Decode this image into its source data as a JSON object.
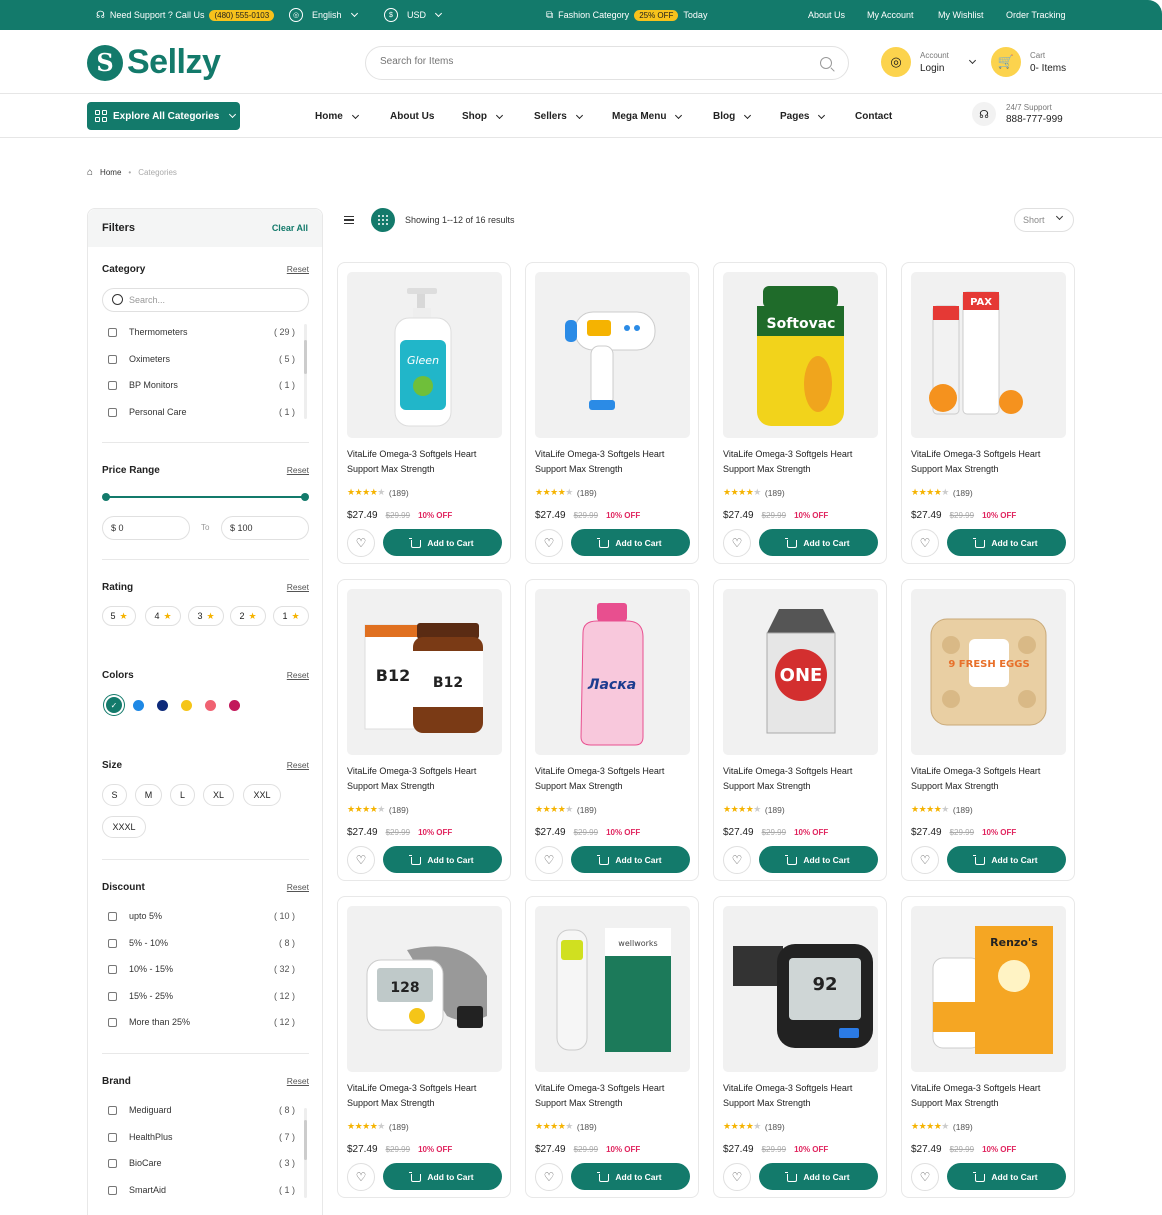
{
  "topbar": {
    "support_text": "Need Support ? Call Us",
    "phone": "(480) 555-0103",
    "language": "English",
    "currency": "USD",
    "promo_text": "Fashion Category",
    "promo_badge": "25% OFF",
    "promo_suffix": "Today",
    "links": [
      "About Us",
      "My Account",
      "My Wishlist",
      "Order Tracking"
    ]
  },
  "header": {
    "brand": "Sellzy",
    "search_placeholder": "Search for Items",
    "account_small": "Account",
    "account_big": "Login",
    "cart_small": "Cart",
    "cart_big": "0- Items"
  },
  "nav": {
    "categories_button": "Explore All Categories",
    "items": [
      "Home",
      "About Us",
      "Shop",
      "Sellers",
      "Mega Menu",
      "Blog",
      "Pages",
      "Contact"
    ],
    "support_small": "24/7 Support",
    "support_phone": "888-777-999"
  },
  "breadcrumb": {
    "home": "Home",
    "current": "Categories"
  },
  "filters": {
    "title": "Filters",
    "clear_all": "Clear All",
    "reset_label": "Reset",
    "category": {
      "title": "Category",
      "search_placeholder": "Search...",
      "items": [
        {
          "label": "Thermometers",
          "count": "( 29 )"
        },
        {
          "label": "Oximeters",
          "count": "( 5 )"
        },
        {
          "label": "BP Monitors",
          "count": "( 1 )"
        },
        {
          "label": "Personal Care",
          "count": "( 1 )"
        }
      ]
    },
    "price": {
      "title": "Price Range",
      "min": "$ 0",
      "to": "To",
      "max": "$ 100",
      "selected_min_fraction": 0,
      "selected_max_fraction": 1
    },
    "rating": {
      "title": "Rating",
      "options": [
        "5",
        "4",
        "3",
        "2",
        "1"
      ]
    },
    "colors": {
      "title": "Colors",
      "swatches": [
        "#137a6b",
        "#1e88e5",
        "#0d2a7a",
        "#f5c518",
        "#f06272",
        "#c2185b"
      ],
      "selected": 0
    },
    "size": {
      "title": "Size",
      "options": [
        "S",
        "M",
        "L",
        "XL",
        "XXL",
        "XXXL"
      ]
    },
    "discount": {
      "title": "Discount",
      "items": [
        {
          "label": "upto 5%",
          "count": "( 10 )"
        },
        {
          "label": "5% - 10%",
          "count": "( 8 )"
        },
        {
          "label": "10% - 15%",
          "count": "( 32 )"
        },
        {
          "label": "15% - 25%",
          "count": "( 12 )"
        },
        {
          "label": "More than  25%",
          "count": "( 12 )"
        }
      ]
    },
    "brand": {
      "title": "Brand",
      "items": [
        {
          "label": "Mediguard",
          "count": "( 8 )"
        },
        {
          "label": "HealthPlus",
          "count": "( 7 )"
        },
        {
          "label": "BioCare",
          "count": "( 3 )"
        },
        {
          "label": "SmartAid",
          "count": "( 1 )"
        }
      ]
    }
  },
  "results": {
    "showing": "Showing 1--12 of 16 results",
    "sort": "Short"
  },
  "product_template": {
    "name": "VitaLife Omega-3 Softgels Heart Support Max Strength",
    "rating_count": "(189)",
    "stars": 4,
    "price": "$27.49",
    "old_price": "$29.99",
    "discount": "10% OFF",
    "cart_label": "Add to Cart"
  },
  "products": [
    {
      "image": "hand-sanitizer-bottle",
      "text": "Gleen",
      "color": "#e9f6f4",
      "accent": "#21b6c9"
    },
    {
      "image": "infrared-thermometer",
      "text": "",
      "color": "#eef3fb",
      "accent": "#2b8be6"
    },
    {
      "image": "supplement-jar",
      "text": "Softovac",
      "color": "#fff4c2",
      "accent": "#1f6b2a"
    },
    {
      "image": "vitamin-c-tubes",
      "text": "PAX",
      "color": "#fff",
      "accent": "#e53935"
    },
    {
      "image": "vitamin-b12-bottles",
      "text": "B12",
      "color": "#fff",
      "accent": "#e07020"
    },
    {
      "image": "detergent-bottle",
      "text": "Ласка",
      "color": "#f8c8dc",
      "accent": "#e84f8f"
    },
    {
      "image": "juice-carton",
      "text": "ONE",
      "color": "#e6e6e6",
      "accent": "#d32f2f"
    },
    {
      "image": "egg-carton",
      "text": "9 FRESH EGGS",
      "color": "#e9cfa3",
      "accent": "#e8702a"
    },
    {
      "image": "blood-pressure-monitor",
      "text": "128",
      "color": "#fff",
      "accent": "#f5c518"
    },
    {
      "image": "digital-thermometer-box",
      "text": "wellworks",
      "color": "#fff",
      "accent": "#1c7a5a"
    },
    {
      "image": "bp-monitor-black",
      "text": "92",
      "color": "#eee",
      "accent": "#222"
    },
    {
      "image": "vitamin-c-kids-box",
      "text": "Renzo's",
      "color": "#fff",
      "accent": "#f5a623"
    }
  ]
}
